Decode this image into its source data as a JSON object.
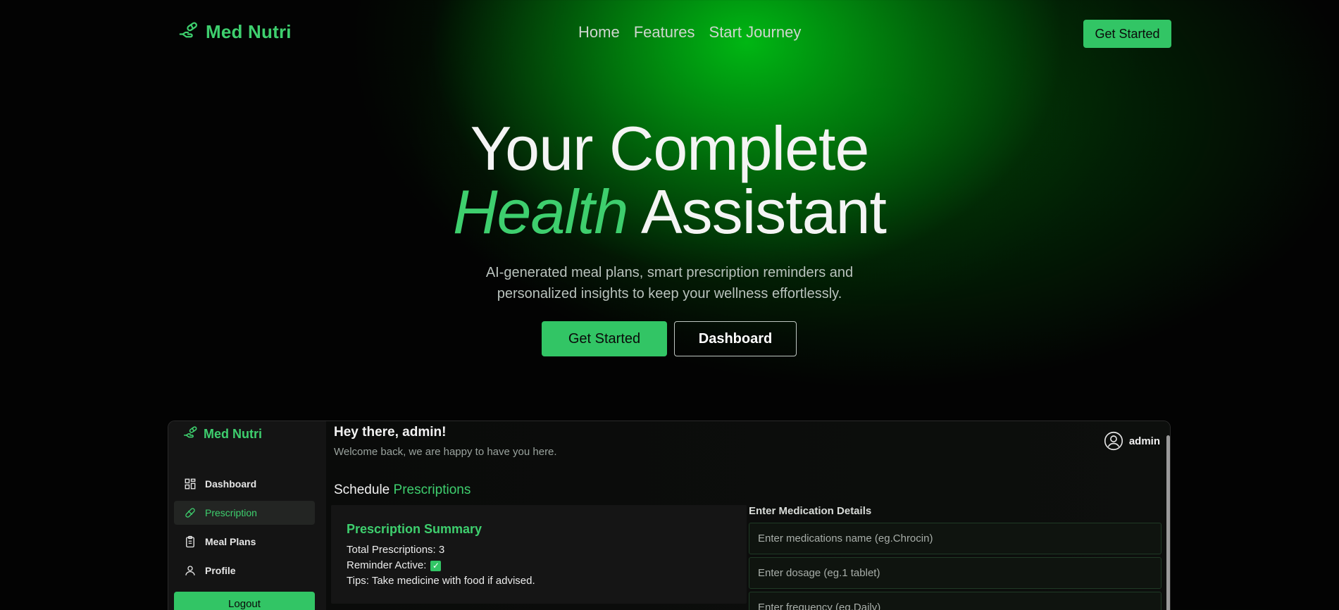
{
  "nav": {
    "brand": "Med Nutri",
    "links": [
      "Home",
      "Features",
      "Start Journey"
    ],
    "cta": "Get Started"
  },
  "hero": {
    "title_line1": "Your Complete",
    "title_accent": "Health",
    "title_rest": " Assistant",
    "subtitle_line1": "AI-generated meal plans, smart prescription reminders and",
    "subtitle_line2": "personalized insights to keep your wellness effortlessly.",
    "primary_button": "Get Started",
    "secondary_button": "Dashboard"
  },
  "preview": {
    "brand": "Med Nutri",
    "menu": [
      "Dashboard",
      "Prescription",
      "Meal Plans",
      "Profile"
    ],
    "active_menu": "Prescription",
    "logout": "Logout",
    "greeting": "Hey there, admin!",
    "welcome": "Welcome back, we are happy to have you here.",
    "user": "admin",
    "schedule_prefix": "Schedule ",
    "schedule_accent": "Prescriptions",
    "summary": {
      "title": "Prescription Summary",
      "total": "Total Prescriptions: 3",
      "reminder": "Reminder Active:",
      "reminder_check": "✓",
      "tips": "Tips: Take medicine with food if advised."
    },
    "form": {
      "title": "Enter Medication Details",
      "name_placeholder": "Enter medications name (eg.Chrocin)",
      "dosage_placeholder": "Enter dosage (eg.1 tablet)",
      "frequency_placeholder": "Enter frequency (eg.Daily)"
    }
  },
  "colors": {
    "accent": "#3ecf6e",
    "button": "#32c565",
    "background": "#030303"
  }
}
